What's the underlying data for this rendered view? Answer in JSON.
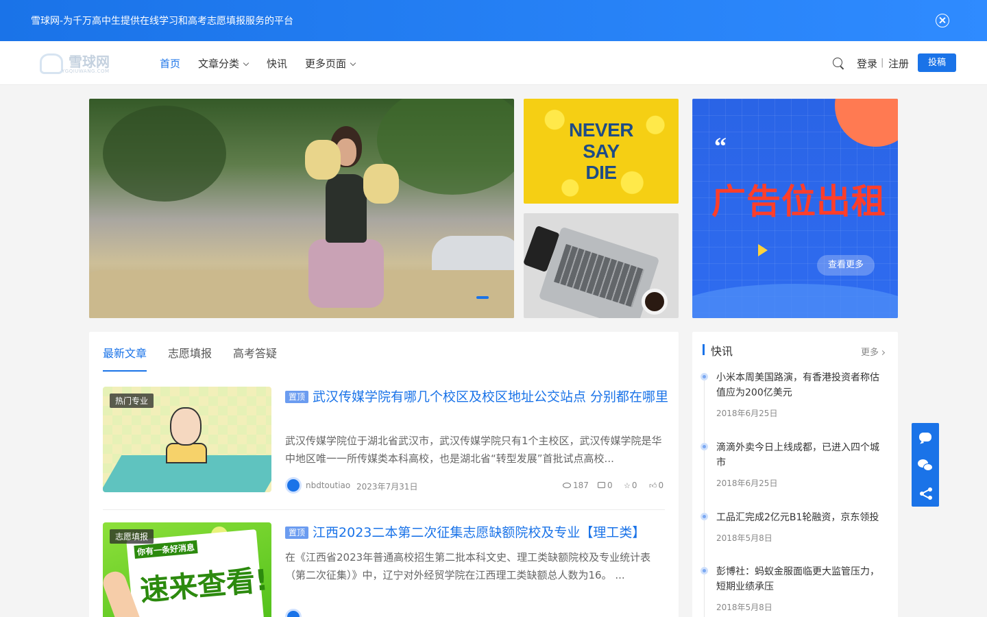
{
  "topbar": {
    "text": "雪球网-为千万高中生提供在线学习和高考志愿填报服务的平台",
    "close_icon": "close-circle-icon"
  },
  "header": {
    "logo_text": "雪球网",
    "logo_sub": "YGQIUWANG.COM",
    "nav": [
      {
        "label": "首页",
        "active": true
      },
      {
        "label": "文章分类",
        "dropdown": true
      },
      {
        "label": "快讯"
      },
      {
        "label": "更多页面",
        "dropdown": true
      }
    ],
    "search_icon": "search-icon",
    "login": "登录",
    "separator": "|",
    "register": "注册",
    "submit": "投稿"
  },
  "hero": {
    "side_slogan": [
      "NEVER",
      "SAY",
      "DIE"
    ],
    "ad_quote": "“",
    "ad_title": "广告位出租",
    "ad_button": "查看更多"
  },
  "tabs": [
    "最新文章",
    "志愿填报",
    "高考答疑"
  ],
  "articles": [
    {
      "category": "热门专业",
      "pin": "置顶",
      "title": "武汉传媒学院有哪几个校区及校区地址公交站点 分别都在哪里",
      "excerpt": "武汉传媒学院位于湖北省武汉市，武汉传媒学院只有1个主校区，武汉传媒学院是华中地区唯一一所传媒类本科高校，也是湖北省“转型发展”首批试点高校...",
      "author": "nbdtoutiao",
      "date": "2023年7月31日",
      "views": "187",
      "comments": "0",
      "favorites": "0",
      "likes": "0"
    },
    {
      "category": "志愿填报",
      "pin": "置顶",
      "title": "江西2023二本第二次征集志愿缺额院校及专业【理工类】",
      "excerpt": "在《江西省2023年普通高校招生第二批本科文史、理工类缺额院校及专业统计表（第二次征集）》中，辽宁对外经贸学院在江西理工类缺额总人数为16。 ...",
      "thumb_small": "你有一条好消息",
      "thumb_big": "速来查看!"
    }
  ],
  "sidebar": {
    "title": "快讯",
    "more": "更多",
    "flashes": [
      {
        "text": "小米本周美国路演，有香港投资者称估值应为200亿美元",
        "date": "2018年6月25日"
      },
      {
        "text": "滴滴外卖今日上线成都，已进入四个城市",
        "date": "2018年6月25日"
      },
      {
        "text": "工品汇完成2亿元B1轮融资，京东领投",
        "date": "2018年5月8日"
      },
      {
        "text": "彭博社：蚂蚁金服面临更大监管压力，短期业绩承压",
        "date": "2018年5月8日"
      }
    ]
  },
  "float_toolbar": [
    "chat-bubble-icon",
    "wechat-icon",
    "share-icon"
  ],
  "colors": {
    "accent": "#1a73e8",
    "ad_title": "#ff3e2a"
  }
}
